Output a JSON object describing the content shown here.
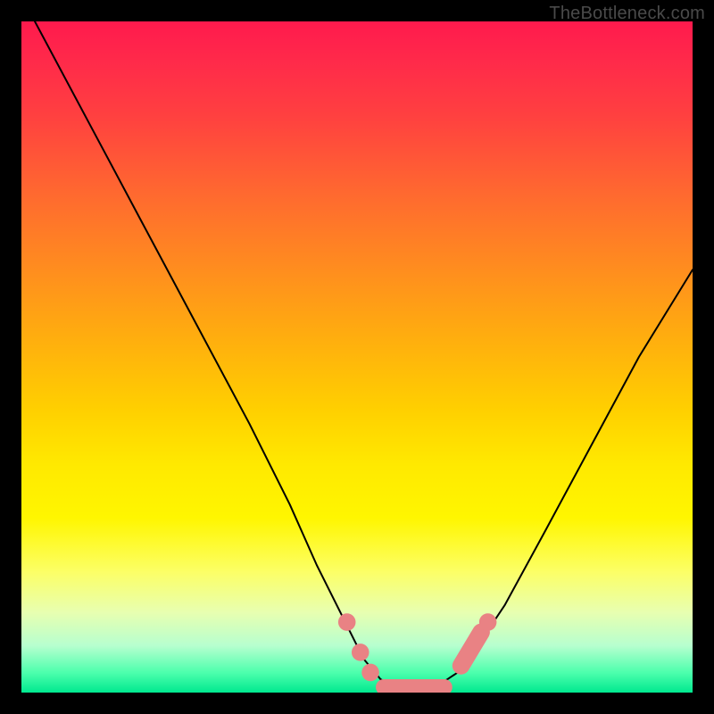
{
  "watermark": "TheBottleneck.com",
  "chart_data": {
    "type": "line",
    "title": "",
    "xlabel": "",
    "ylabel": "",
    "xlim": [
      0,
      100
    ],
    "ylim": [
      0,
      100
    ],
    "grid": false,
    "legend": false,
    "series": [
      {
        "name": "curve",
        "stroke": "#000000",
        "stroke_width": 2,
        "x": [
          2,
          10,
          18,
          26,
          34,
          40,
          44,
          48,
          51,
          53.5,
          56,
          59,
          62,
          65,
          68,
          72,
          78,
          85,
          92,
          100
        ],
        "y": [
          100,
          85,
          70,
          55,
          40,
          28,
          19,
          11,
          5,
          2,
          0.5,
          0.5,
          1,
          3,
          7,
          13,
          24,
          37,
          50,
          63
        ]
      }
    ],
    "markers": [
      {
        "name": "pink-dot",
        "shape": "circle",
        "color": "#e98284",
        "x": 48.5,
        "y": 10.5,
        "r": 1.3
      },
      {
        "name": "pink-dot",
        "shape": "circle",
        "color": "#e98284",
        "x": 50.5,
        "y": 6.0,
        "r": 1.3
      },
      {
        "name": "pink-dot",
        "shape": "circle",
        "color": "#e98284",
        "x": 52.0,
        "y": 3.0,
        "r": 1.3
      },
      {
        "name": "pink-capsule",
        "shape": "capsule-h",
        "color": "#e98284",
        "x1": 54.0,
        "x2": 63.0,
        "y": 0.8,
        "thickness": 2.4
      },
      {
        "name": "pink-capsule",
        "shape": "capsule-d",
        "color": "#e98284",
        "x1": 65.5,
        "y1": 4.0,
        "x2": 68.5,
        "y2": 9.0,
        "thickness": 2.6
      },
      {
        "name": "pink-dot",
        "shape": "circle",
        "color": "#e98284",
        "x": 69.5,
        "y": 10.5,
        "r": 1.3
      }
    ],
    "background_gradient": {
      "direction": "top-to-bottom",
      "stops": [
        {
          "pos": 0,
          "color": "#ff1a4d"
        },
        {
          "pos": 26,
          "color": "#ff6a2f"
        },
        {
          "pos": 58,
          "color": "#ffd000"
        },
        {
          "pos": 82,
          "color": "#fcff66"
        },
        {
          "pos": 100,
          "color": "#00e98f"
        }
      ]
    }
  }
}
